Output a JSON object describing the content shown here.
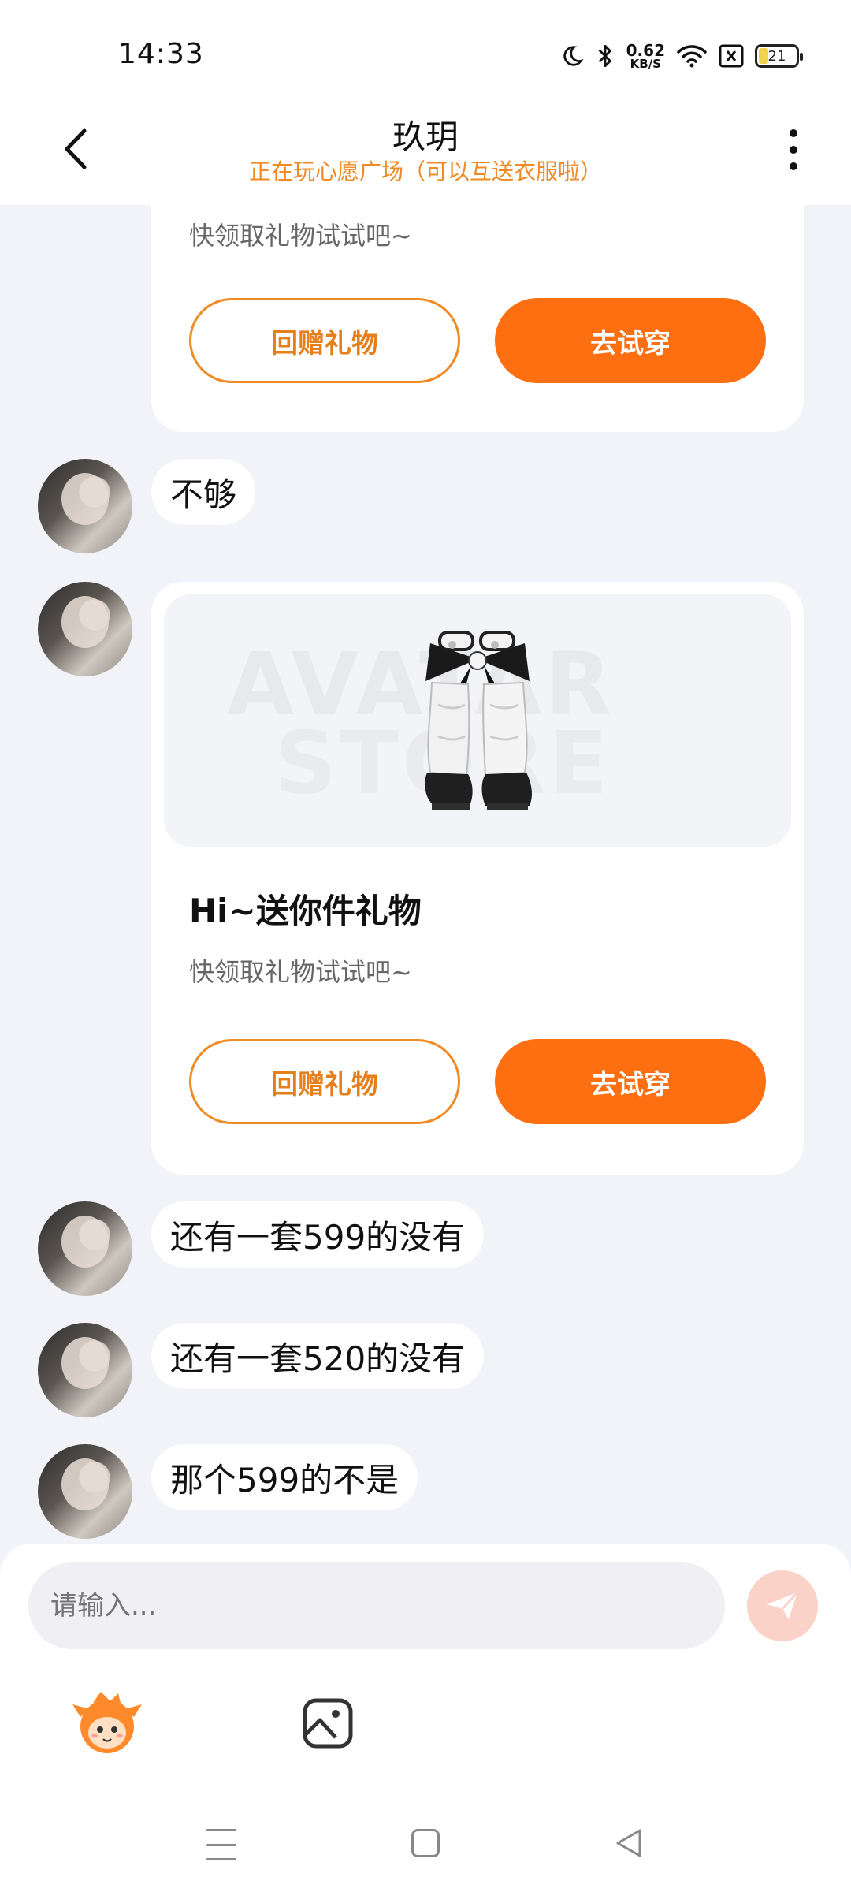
{
  "status_bar": {
    "time": "14:33",
    "net_speed_value": "0.62",
    "net_speed_unit": "KB/S",
    "battery": "21",
    "icons": [
      "moon-icon",
      "bluetooth-icon",
      "wifi-icon",
      "sim-off-icon",
      "battery-icon"
    ]
  },
  "header": {
    "title": "玖玥",
    "subtitle": "正在玩心愿广场（可以互送衣服啦）",
    "back_icon": "back-arrow-icon",
    "more_icon": "more-vertical-icon"
  },
  "messages": {
    "card1": {
      "subtitle": "快领取礼物试试吧~",
      "return_gift_label": "回赠礼物",
      "try_on_label": "去试穿"
    },
    "msg1": "不够",
    "card2": {
      "image_watermark_top": "AVATAR",
      "image_watermark_bottom": "STORE",
      "title": "Hi~送你件礼物",
      "subtitle": "快领取礼物试试吧~",
      "return_gift_label": "回赠礼物",
      "try_on_label": "去试穿"
    },
    "msg2": "还有一套599的没有",
    "msg3": "还有一套520的没有",
    "msg4": "那个599的不是"
  },
  "input": {
    "placeholder": "请输入..."
  },
  "colors": {
    "accent": "#fe6f12",
    "accent_text": "#f08a24",
    "background": "#f2f3f8"
  }
}
